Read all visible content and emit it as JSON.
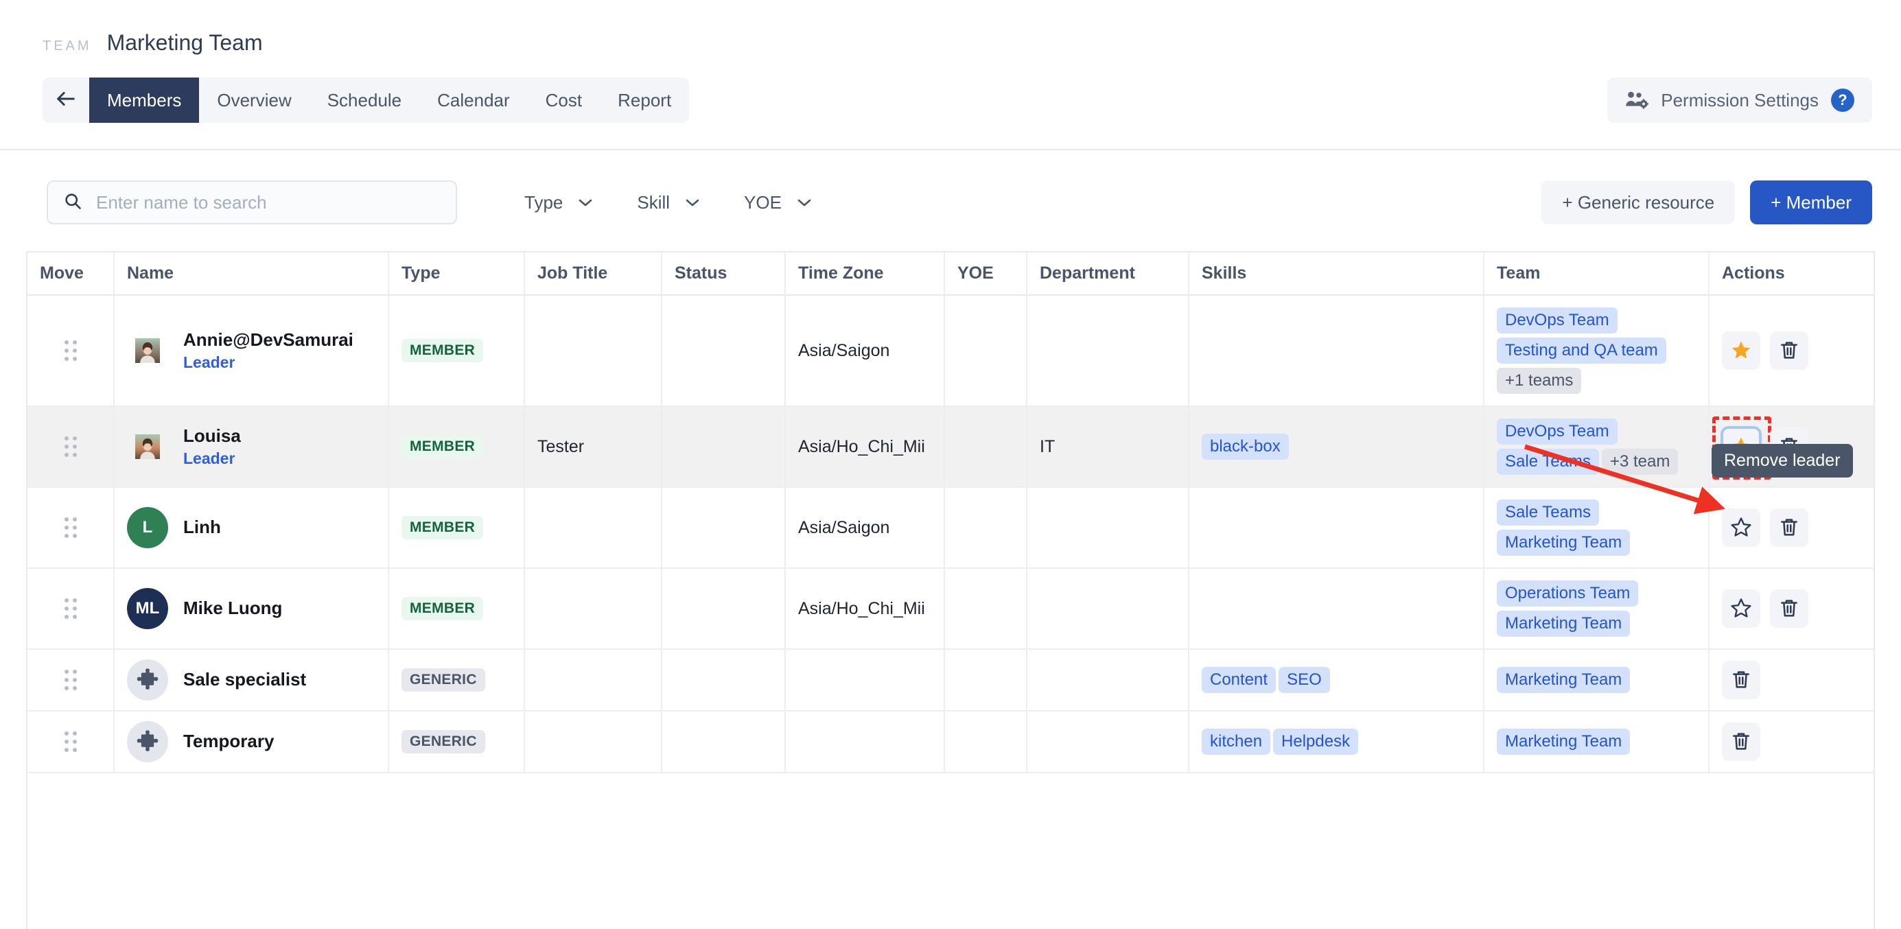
{
  "header": {
    "kicker": "TEAM",
    "title": "Marketing Team",
    "back_icon": "arrow-left-icon",
    "tabs": [
      {
        "label": "Members",
        "active": true
      },
      {
        "label": "Overview",
        "active": false
      },
      {
        "label": "Schedule",
        "active": false
      },
      {
        "label": "Calendar",
        "active": false
      },
      {
        "label": "Cost",
        "active": false
      },
      {
        "label": "Report",
        "active": false
      }
    ],
    "permission": {
      "label": "Permission Settings",
      "icon": "users-gear-icon",
      "help_label": "?",
      "help_color": "#2563c9"
    }
  },
  "toolbar": {
    "search": {
      "placeholder": "Enter name to search",
      "value": "",
      "icon": "search-icon"
    },
    "filters": [
      {
        "label": "Type",
        "icon": "chevron-down-icon"
      },
      {
        "label": "Skill",
        "icon": "chevron-down-icon"
      },
      {
        "label": "YOE",
        "icon": "chevron-down-icon"
      }
    ],
    "generic_resource_label": "+ Generic resource",
    "add_member_label": "+ Member",
    "add_member_color": "#2657c4"
  },
  "table": {
    "columns": [
      "Move",
      "Name",
      "Type",
      "Job Title",
      "Status",
      "Time Zone",
      "YOE",
      "Department",
      "Skills",
      "Team",
      "Actions"
    ],
    "rows": [
      {
        "name": "Annie@DevSamurai",
        "role": "Leader",
        "avatar_kind": "photo",
        "avatar_color": "#8d7f6d",
        "avatar_initials": "",
        "type": "MEMBER",
        "type_kind": "member",
        "job_title": "",
        "status": "",
        "time_zone": "Asia/Saigon",
        "yoe": "",
        "department": "",
        "skills": [],
        "teams": [
          "DevOps Team",
          "Testing and QA team"
        ],
        "teams_more": "+1 teams",
        "star_state": "filled",
        "highlighted": false
      },
      {
        "name": "Louisa",
        "role": "Leader",
        "avatar_kind": "photo",
        "avatar_color": "#c98a63",
        "avatar_initials": "",
        "type": "MEMBER",
        "type_kind": "member",
        "job_title": "Tester",
        "status": "",
        "time_zone": "Asia/Ho_Chi_Mii",
        "yoe": "",
        "department": "IT",
        "skills": [
          "black-box"
        ],
        "teams": [
          "DevOps Team",
          "Sale Teams"
        ],
        "teams_more": "+3 team",
        "star_state": "filled",
        "highlighted": true
      },
      {
        "name": "Linh",
        "role": "",
        "avatar_kind": "initials",
        "avatar_color": "#2f8055",
        "avatar_initials": "L",
        "type": "MEMBER",
        "type_kind": "member",
        "job_title": "",
        "status": "",
        "time_zone": "Asia/Saigon",
        "yoe": "",
        "department": "",
        "skills": [],
        "teams": [
          "Sale Teams",
          "Marketing Team"
        ],
        "teams_more": "",
        "star_state": "outline",
        "highlighted": false
      },
      {
        "name": "Mike Luong",
        "role": "",
        "avatar_kind": "initials",
        "avatar_color": "#1e2f56",
        "avatar_initials": "ML",
        "type": "MEMBER",
        "type_kind": "member",
        "job_title": "",
        "status": "",
        "time_zone": "Asia/Ho_Chi_Mii",
        "yoe": "",
        "department": "",
        "skills": [],
        "teams": [
          "Operations Team",
          "Marketing Team"
        ],
        "teams_more": "",
        "star_state": "outline",
        "highlighted": false
      },
      {
        "name": "Sale specialist",
        "role": "",
        "avatar_kind": "puzzle",
        "avatar_color": "#e3e6ec",
        "avatar_initials": "",
        "type": "GENERIC",
        "type_kind": "generic",
        "job_title": "",
        "status": "",
        "time_zone": "",
        "yoe": "",
        "department": "",
        "skills": [
          "Content",
          "SEO"
        ],
        "teams": [
          "Marketing Team"
        ],
        "teams_more": "",
        "star_state": "none",
        "highlighted": false
      },
      {
        "name": "Temporary",
        "role": "",
        "avatar_kind": "puzzle",
        "avatar_color": "#e3e6ec",
        "avatar_initials": "",
        "type": "GENERIC",
        "type_kind": "generic",
        "job_title": "",
        "status": "",
        "time_zone": "",
        "yoe": "",
        "department": "",
        "skills": [
          "kitchen",
          "Helpdesk"
        ],
        "teams": [
          "Marketing Team"
        ],
        "teams_more": "",
        "star_state": "none",
        "highlighted": false
      }
    ]
  },
  "overlay": {
    "tooltip_text": "Remove leader",
    "tooltip_bg": "#4b5568",
    "annotation_arrow_color": "#ef3124",
    "highlight_box_color": "#ef3124"
  }
}
